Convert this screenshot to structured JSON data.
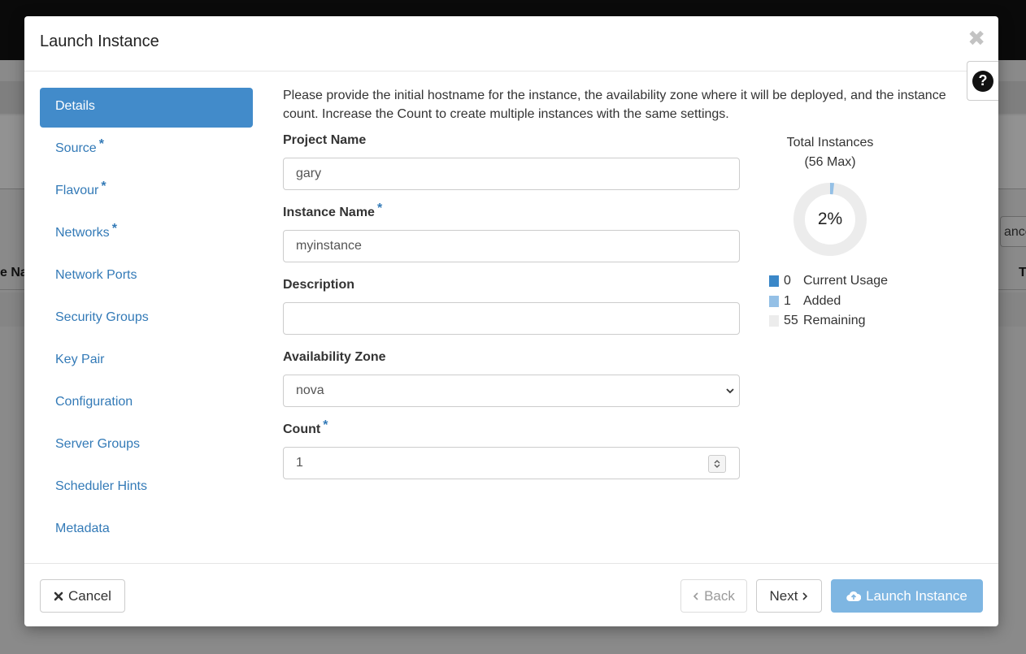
{
  "background": {
    "left_fragment": "e Nan",
    "right_fragment": "Ta",
    "right_button_fragment": "ance"
  },
  "modal": {
    "title": "Launch Instance",
    "close_glyph": "✖",
    "help_glyph": "?"
  },
  "wizard": {
    "steps": [
      {
        "label": "Details",
        "required": false,
        "active": true
      },
      {
        "label": "Source",
        "required": true
      },
      {
        "label": "Flavour",
        "required": true
      },
      {
        "label": "Networks",
        "required": true
      },
      {
        "label": "Network Ports",
        "required": false
      },
      {
        "label": "Security Groups",
        "required": false
      },
      {
        "label": "Key Pair",
        "required": false
      },
      {
        "label": "Configuration",
        "required": false
      },
      {
        "label": "Server Groups",
        "required": false
      },
      {
        "label": "Scheduler Hints",
        "required": false
      },
      {
        "label": "Metadata",
        "required": false
      }
    ],
    "required_marker": "*"
  },
  "details": {
    "intro": "Please provide the initial hostname for the instance, the availability zone where it will be deployed, and the instance count. Increase the Count to create multiple instances with the same settings.",
    "project_name": {
      "label": "Project Name",
      "value": "gary"
    },
    "instance_name": {
      "label": "Instance Name",
      "value": "myinstance"
    },
    "description": {
      "label": "Description",
      "value": ""
    },
    "availability_zone": {
      "label": "Availability Zone",
      "value": "nova"
    },
    "count": {
      "label": "Count",
      "value": "1"
    }
  },
  "usage": {
    "title_line1": "Total Instances",
    "title_line2": "(56 Max)",
    "percent_label": "2%",
    "max": 56,
    "legend": [
      {
        "count": "0",
        "label": "Current Usage",
        "color": "#3a87c8"
      },
      {
        "count": "1",
        "label": "Added",
        "color": "#94c0e6"
      },
      {
        "count": "55",
        "label": "Remaining",
        "color": "#ececec"
      }
    ]
  },
  "footer": {
    "cancel": "Cancel",
    "back": "Back",
    "next": "Next",
    "launch": "Launch Instance"
  },
  "colors": {
    "accent": "#428bca",
    "link": "#337ab7",
    "launch_button": "#7eb6e2"
  }
}
